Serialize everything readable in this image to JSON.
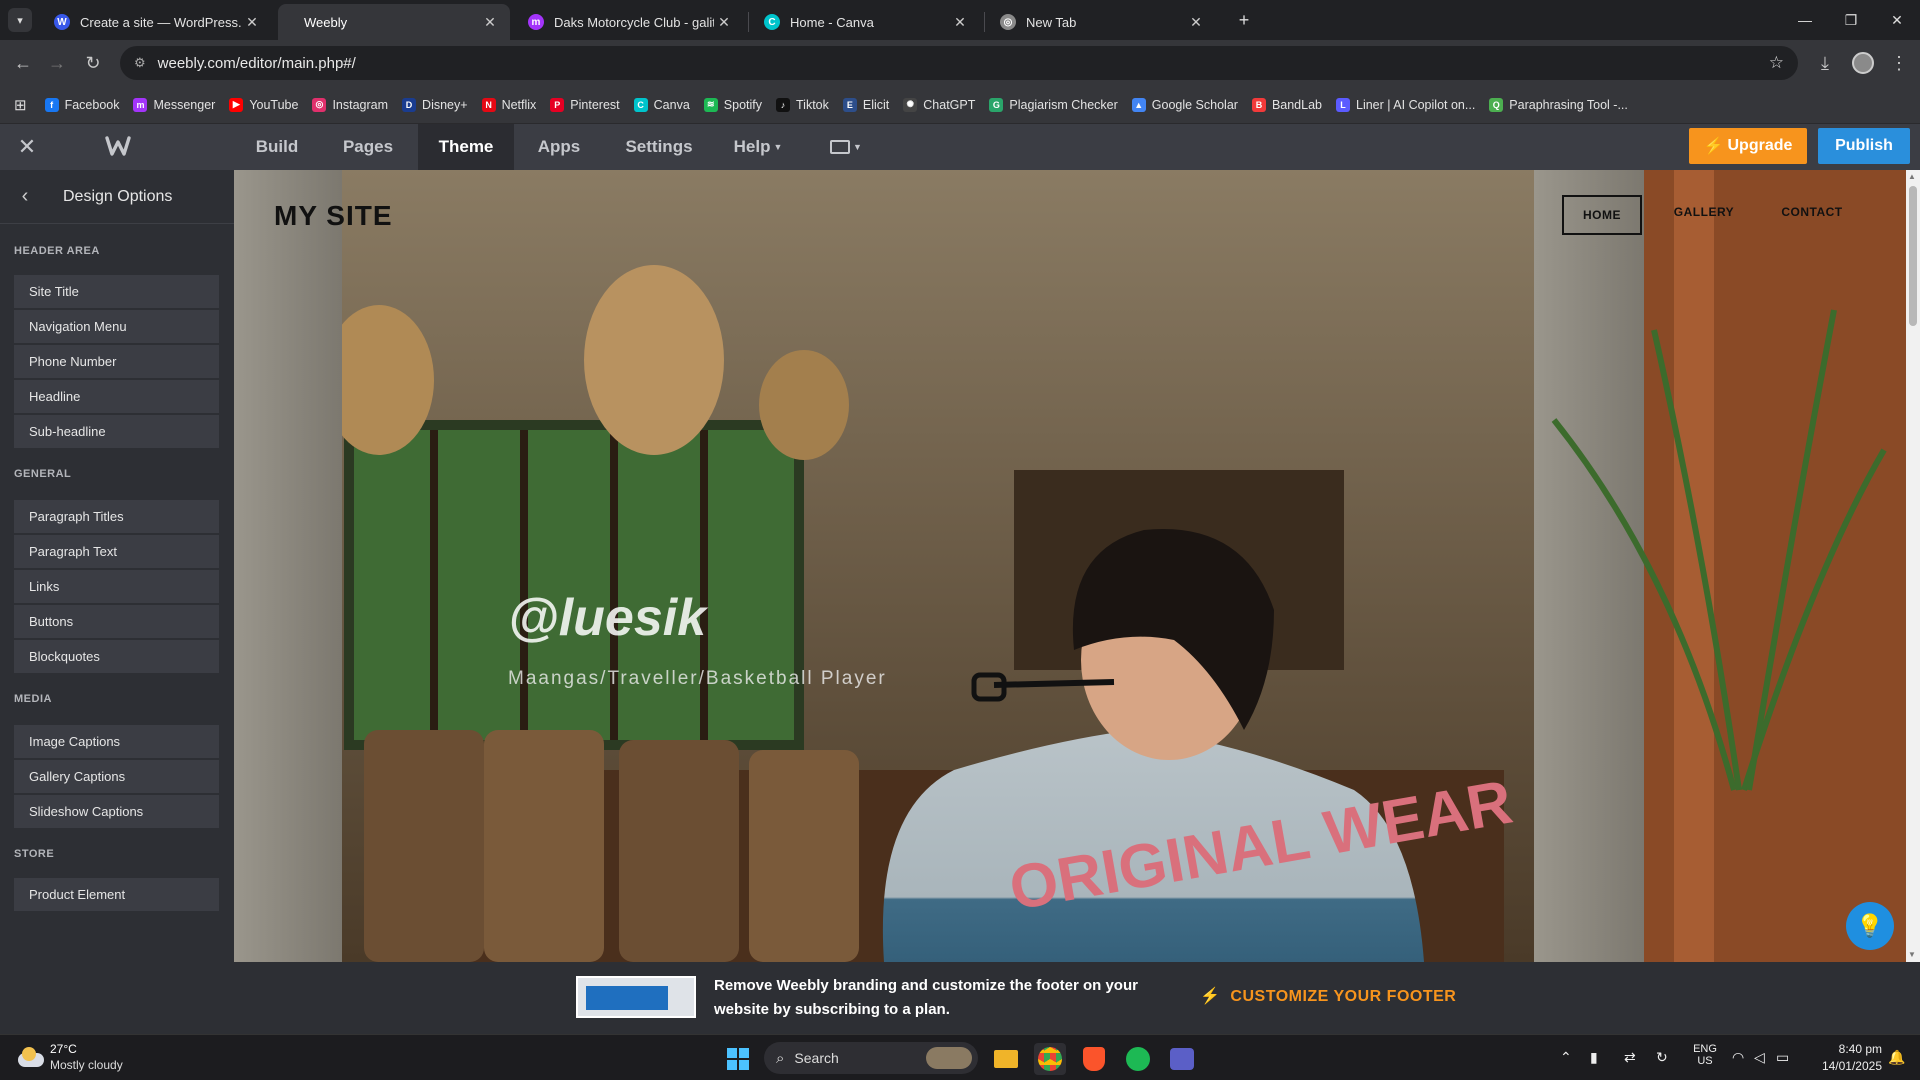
{
  "browser": {
    "tabs": [
      {
        "title": "Create a site — WordPress.com",
        "icon": "wordpress-icon",
        "color": "#3858e9",
        "active": false
      },
      {
        "title": "Weebly",
        "icon": "weebly-icon",
        "color": "#35363a",
        "active": true
      },
      {
        "title": "Daks Motorcycle Club - galit ak",
        "icon": "messenger-icon",
        "color": "#a334fa",
        "active": false
      },
      {
        "title": "Home - Canva",
        "icon": "canva-icon",
        "color": "#00c4cc",
        "active": false
      },
      {
        "title": "New Tab",
        "icon": "chrome-icon",
        "color": "#8a8a8a",
        "active": false
      }
    ],
    "url": "weebly.com/editor/main.php#/",
    "bookmarks": [
      {
        "label": "Facebook",
        "color": "#1877f2"
      },
      {
        "label": "Messenger",
        "color": "#a334fa"
      },
      {
        "label": "YouTube",
        "color": "#ff0000"
      },
      {
        "label": "Instagram",
        "color": "#e1306c"
      },
      {
        "label": "Disney+",
        "color": "#1a3c8f"
      },
      {
        "label": "Netflix",
        "color": "#e50914"
      },
      {
        "label": "Pinterest",
        "color": "#e60023"
      },
      {
        "label": "Canva",
        "color": "#00c4cc"
      },
      {
        "label": "Spotify",
        "color": "#1db954"
      },
      {
        "label": "Tiktok",
        "color": "#111111"
      },
      {
        "label": "Elicit",
        "color": "#2d4e8a"
      },
      {
        "label": "ChatGPT",
        "color": "#444444"
      },
      {
        "label": "Plagiarism Checker",
        "color": "#2aa56a"
      },
      {
        "label": "Google Scholar",
        "color": "#4285f4"
      },
      {
        "label": "BandLab",
        "color": "#f23a3a"
      },
      {
        "label": "Liner | AI Copilot on...",
        "color": "#5b5bff"
      },
      {
        "label": "Paraphrasing Tool -...",
        "color": "#4caf50"
      }
    ]
  },
  "editor": {
    "nav": [
      "Build",
      "Pages",
      "Theme",
      "Apps",
      "Settings",
      "Help"
    ],
    "active_nav": "Theme",
    "upgrade_label": "Upgrade",
    "publish_label": "Publish"
  },
  "sidebar": {
    "title": "Design Options",
    "sections": [
      {
        "name": "HEADER AREA",
        "items": [
          "Site Title",
          "Navigation Menu",
          "Phone Number",
          "Headline",
          "Sub-headline"
        ]
      },
      {
        "name": "GENERAL",
        "items": [
          "Paragraph Titles",
          "Paragraph Text",
          "Links",
          "Buttons",
          "Blockquotes"
        ]
      },
      {
        "name": "MEDIA",
        "items": [
          "Image Captions",
          "Gallery Captions",
          "Slideshow Captions"
        ]
      },
      {
        "name": "STORE",
        "items": [
          "Product Element"
        ]
      }
    ]
  },
  "site": {
    "title": "MY SITE",
    "menu": [
      "HOME",
      "GALLERY",
      "CONTACT"
    ],
    "headline": "@luesik",
    "subheadline": "Maangas/Traveller/Basketball Player"
  },
  "footer_banner": {
    "text": "Remove Weebly branding and customize the footer on your website by subscribing to a plan.",
    "cta": "CUSTOMIZE YOUR FOOTER"
  },
  "taskbar": {
    "temperature": "27°C",
    "weather": "Mostly cloudy",
    "search_placeholder": "Search",
    "lang_top": "ENG",
    "lang_bottom": "US",
    "time": "8:40 pm",
    "date": "14/01/2025"
  },
  "colors": {
    "upgrade": "#f7941d",
    "publish": "#2a8fdc",
    "cta": "#f7941d"
  }
}
